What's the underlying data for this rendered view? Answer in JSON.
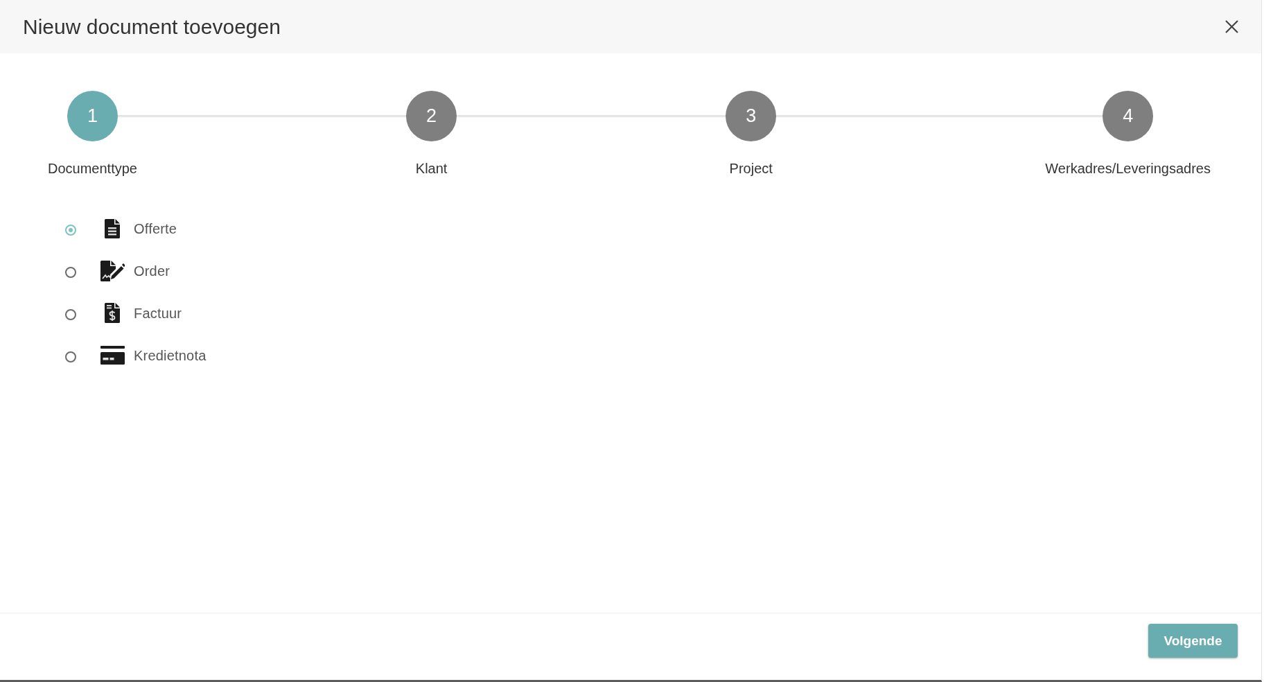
{
  "dialog": {
    "title": "Nieuw document toevoegen"
  },
  "steps": [
    {
      "number": "1",
      "label": "Documenttype",
      "active": true
    },
    {
      "number": "2",
      "label": "Klant",
      "active": false
    },
    {
      "number": "3",
      "label": "Project",
      "active": false
    },
    {
      "number": "4",
      "label": "Werkadres/Leveringsadres",
      "active": false
    }
  ],
  "options": [
    {
      "label": "Offerte",
      "kind": "document",
      "selected": true
    },
    {
      "label": "Order",
      "kind": "signature",
      "selected": false
    },
    {
      "label": "Factuur",
      "kind": "invoice",
      "selected": false
    },
    {
      "label": "Kredietnota",
      "kind": "card",
      "selected": false
    }
  ],
  "footer": {
    "button": "Volgende"
  }
}
